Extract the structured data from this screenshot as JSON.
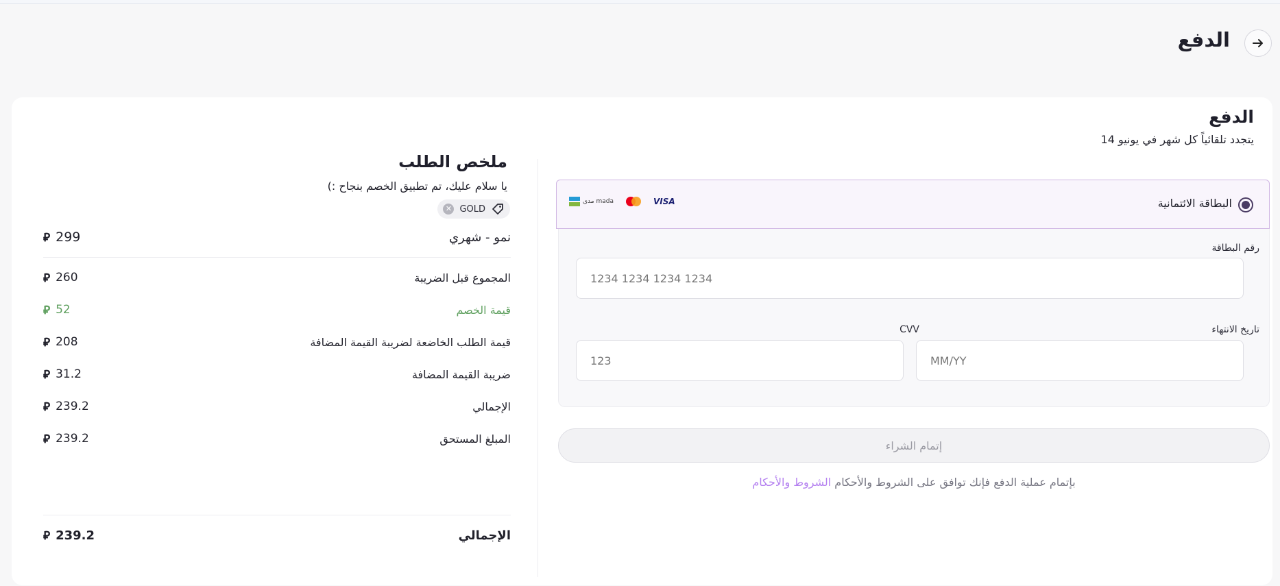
{
  "header": {
    "title": "الدفع",
    "back_icon": "arrow-right-icon"
  },
  "payment": {
    "title": "الدفع",
    "renewal_text": "يتجدد تلقائياً كل شهر في يونيو 14",
    "method": {
      "label": "البطاقة الائتمانية",
      "selected": true,
      "logos": [
        "visa",
        "mastercard",
        "mada"
      ],
      "visa_text": "VISA",
      "mada_text": "مدى mada"
    },
    "card_number": {
      "label": "رقم البطاقة",
      "placeholder": "1234 1234 1234 1234"
    },
    "expiry": {
      "label": "تاريخ الانتهاء",
      "placeholder": "MM/YY"
    },
    "cvv": {
      "label": "CVV",
      "placeholder": "123"
    },
    "submit_label": "إتمام الشراء",
    "terms_text": "بإتمام عملية الدفع فإنك توافق على الشروط والأحكام",
    "terms_link": "الشروط والأحكام"
  },
  "summary": {
    "title": "ملخص الطلب",
    "success_message": "يا سلام عليك، تم تطبيق الخصم بنجاح :)",
    "coupon_code": "GOLD",
    "currency_symbol": "⃁",
    "plan": {
      "label": "نمو - شهري",
      "value": "299"
    },
    "rows": [
      {
        "label": "المجموع قبل الضريبة",
        "value": "260"
      },
      {
        "label": "قيمة الخصم",
        "value": "52",
        "highlight": "#5fa05f"
      },
      {
        "label": "قيمة الطلب الخاضعة لضريبة القيمة المضافة",
        "value": "208"
      },
      {
        "label": "ضريبة القيمة المضافة",
        "value": "31.2"
      },
      {
        "label": "الإجمالي",
        "value": "239.2"
      },
      {
        "label": "المبلغ المستحق",
        "value": "239.2"
      }
    ],
    "total": {
      "label": "الإجمالي",
      "value": "239.2"
    }
  },
  "colors": {
    "accent": "#4a3b63",
    "link": "#b480f0",
    "discount": "#5fa05f",
    "method_border": "#cfb5e3"
  }
}
